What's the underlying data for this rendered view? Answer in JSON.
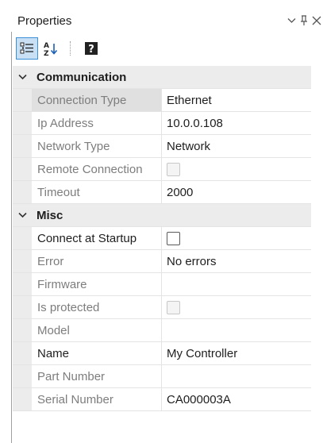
{
  "window": {
    "title": "Properties"
  },
  "title_buttons": [
    {
      "name": "dropdown-chevron-icon"
    },
    {
      "name": "pin-icon"
    },
    {
      "name": "close-icon"
    }
  ],
  "toolbar": {
    "categorized_icon": "categorized-view-icon",
    "alphabetical_icon": "alphabetical-sort-icon",
    "help_icon": "help-icon",
    "help_glyph": "?"
  },
  "categories": [
    {
      "label": "Communication",
      "properties": [
        {
          "name": "Connection Type",
          "value": "Ethernet",
          "editable": false,
          "selected": true,
          "type": "text"
        },
        {
          "name": "Ip Address",
          "value": "10.0.0.108",
          "editable": false,
          "selected": false,
          "type": "text"
        },
        {
          "name": "Network Type",
          "value": "Network",
          "editable": false,
          "selected": false,
          "type": "text"
        },
        {
          "name": "Remote Connection",
          "value": "",
          "editable": false,
          "selected": false,
          "type": "checkbox",
          "checked": false
        },
        {
          "name": "Timeout",
          "value": "2000",
          "editable": false,
          "selected": false,
          "type": "text"
        }
      ]
    },
    {
      "label": "Misc",
      "properties": [
        {
          "name": "Connect at Startup",
          "value": "",
          "editable": true,
          "selected": false,
          "type": "checkbox",
          "checked": false
        },
        {
          "name": "Error",
          "value": "No errors",
          "editable": false,
          "selected": false,
          "type": "text"
        },
        {
          "name": "Firmware",
          "value": "",
          "editable": false,
          "selected": false,
          "type": "text"
        },
        {
          "name": "Is protected",
          "value": "",
          "editable": false,
          "selected": false,
          "type": "checkbox",
          "checked": false
        },
        {
          "name": "Model",
          "value": "",
          "editable": false,
          "selected": false,
          "type": "text"
        },
        {
          "name": "Name",
          "value": "My Controller",
          "editable": true,
          "selected": false,
          "type": "text"
        },
        {
          "name": "Part Number",
          "value": "",
          "editable": false,
          "selected": false,
          "type": "text"
        },
        {
          "name": "Serial Number",
          "value": "CA000003A",
          "editable": false,
          "selected": false,
          "type": "text"
        }
      ]
    }
  ],
  "colors": {
    "active_toolbar_bg": "#c9dff3",
    "active_toolbar_border": "#3d8fd6",
    "category_bg": "#ececec",
    "readonly_text": "#7d7d7d",
    "editable_text": "#1e1e1e"
  }
}
